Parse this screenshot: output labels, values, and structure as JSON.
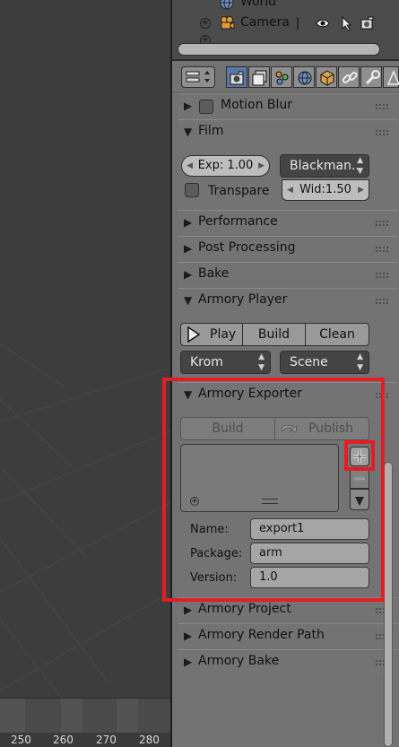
{
  "outliner": {
    "items": [
      {
        "label": "World",
        "icon": "world-icon"
      },
      {
        "label": "Camera",
        "icon": "camera-icon"
      }
    ]
  },
  "timeline": {
    "ticks": [
      "250",
      "260",
      "270",
      "280"
    ]
  },
  "props": {
    "context_tabs": [
      "render-icon",
      "render-layers-icon",
      "scene-icon",
      "world-icon",
      "object-icon",
      "constraints-icon",
      "modifiers-icon",
      "data-icon"
    ],
    "active_tab": "render-icon"
  },
  "panels": {
    "motion_blur": {
      "title": "Motion Blur",
      "expanded": false
    },
    "film": {
      "title": "Film",
      "expanded": true,
      "exposure": "Exp: 1.00",
      "filter_type": "Blackman...",
      "transparent_label": "Transpare",
      "width": "Wid:1.50"
    },
    "performance": {
      "title": "Performance",
      "expanded": false
    },
    "post_processing": {
      "title": "Post Processing",
      "expanded": false
    },
    "bake": {
      "title": "Bake",
      "expanded": false
    },
    "armory_player": {
      "title": "Armory Player",
      "expanded": true,
      "play_label": "Play",
      "build_label": "Build",
      "clean_label": "Clean",
      "runtime": "Krom",
      "camera_mode": "Scene"
    },
    "armory_exporter": {
      "title": "Armory Exporter",
      "expanded": true,
      "build_label": "Build",
      "publish_label": "Publish",
      "name_label": "Name:",
      "name_value": "export1",
      "package_label": "Package:",
      "package_value": "arm",
      "version_label": "Version:",
      "version_value": "1.0"
    },
    "armory_project": {
      "title": "Armory Project",
      "expanded": false
    },
    "armory_render_path": {
      "title": "Armory Render Path",
      "expanded": false
    },
    "armory_bake": {
      "title": "Armory Bake",
      "expanded": false
    }
  },
  "colors": {
    "highlight": "#e51c23",
    "active_tab": "#5a78a8",
    "panel_bg": "#737373",
    "viewport_bg": "#3d3d3d"
  }
}
